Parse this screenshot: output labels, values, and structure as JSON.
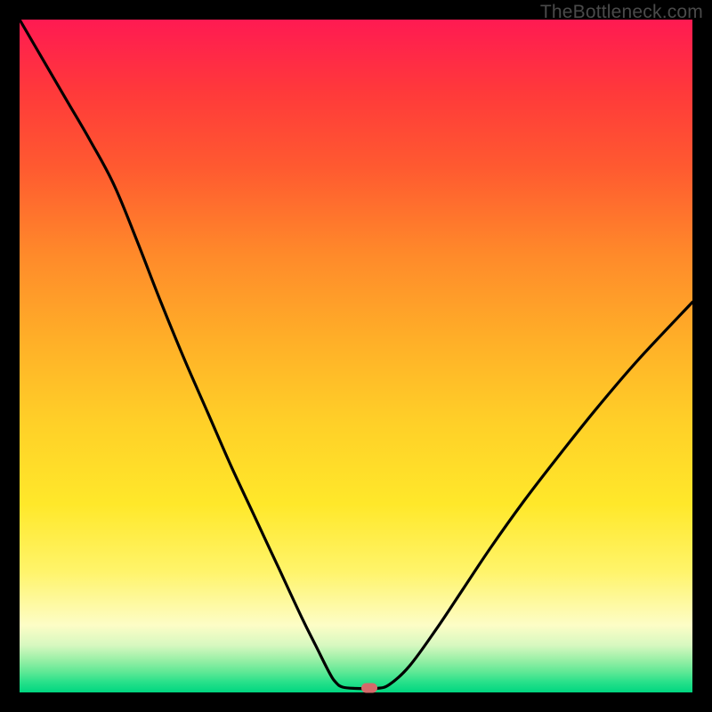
{
  "watermark": "TheBottleneck.com",
  "chart_data": {
    "type": "line",
    "title": "",
    "xlabel": "",
    "ylabel": "",
    "xlim": [
      0,
      100
    ],
    "ylim": [
      0,
      100
    ],
    "grid": false,
    "background": "rainbow-vertical-gradient",
    "series": [
      {
        "name": "bottleneck-curve",
        "x": [
          0,
          3.5,
          7,
          10.5,
          14,
          17.5,
          21,
          24.5,
          28,
          31.5,
          35,
          38.5,
          42,
          44,
          46,
          47,
          48,
          50,
          53,
          55,
          58,
          62,
          66,
          70,
          75,
          80,
          86,
          92,
          100
        ],
        "y": [
          100,
          94,
          88,
          82,
          75.5,
          67,
          58,
          49.5,
          41.5,
          33.5,
          26,
          18.5,
          11,
          7,
          3,
          1.5,
          0.8,
          0.6,
          0.6,
          1.2,
          4,
          9.5,
          15.5,
          21.5,
          28.5,
          35,
          42.5,
          49.5,
          58
        ]
      }
    ],
    "marker": {
      "x": 52,
      "y": 0.6,
      "color": "#d46a6a"
    },
    "colors": {
      "top": "#ff1a52",
      "bottom": "#00d680",
      "curve": "#000000",
      "frame": "#000000"
    }
  }
}
